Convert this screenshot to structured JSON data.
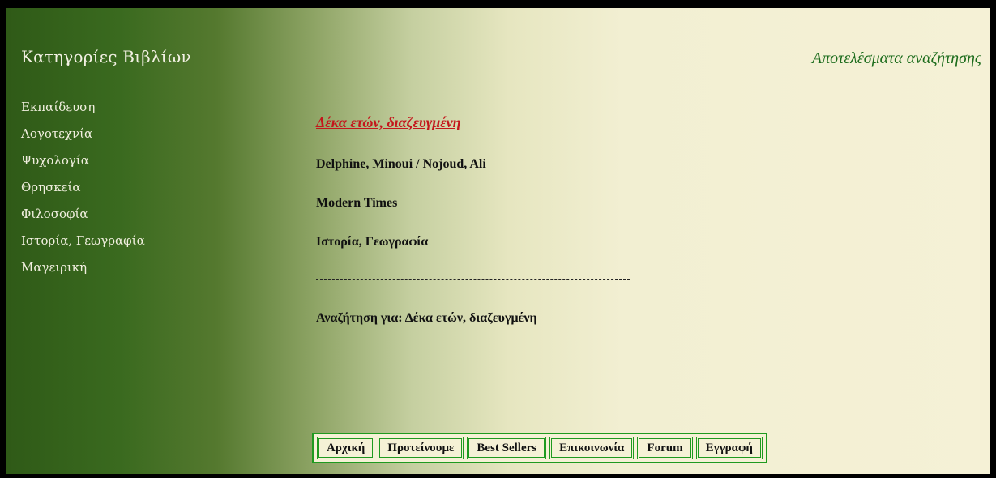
{
  "sidebar": {
    "title": "Κατηγορίες Βιβλίων",
    "categories": [
      "Εκπαίδευση",
      "Λογοτεχνία",
      "Ψυχολογία",
      "Θρησκεία",
      "Φιλοσοφία",
      "Ιστορία, Γεωγραφία",
      "Μαγειρική"
    ]
  },
  "results": {
    "heading": "Αποτελέσματα αναζήτησης",
    "book": {
      "title": "Δέκα ετών, διαζευγμένη",
      "authors": "Delphine, Minoui / Nojoud, Ali",
      "publisher": "Modern Times",
      "category": "Ιστορία, Γεωγραφία"
    },
    "divider_text": "---------------------------------------------------------",
    "search_summary": "Αναζήτηση για: Δέκα ετών, διαζευγμένη"
  },
  "nav": {
    "items": [
      "Αρχική",
      "Προτείνουμε",
      "Best Sellers",
      "Επικοινωνία",
      "Forum",
      "Εγγραφή"
    ]
  },
  "colors": {
    "gradient_dark": "#2f5a17",
    "gradient_light": "#f5f1d6",
    "title_link": "#c4161c",
    "heading_green": "#1b6b1b",
    "nav_border": "#1f9a1f"
  }
}
